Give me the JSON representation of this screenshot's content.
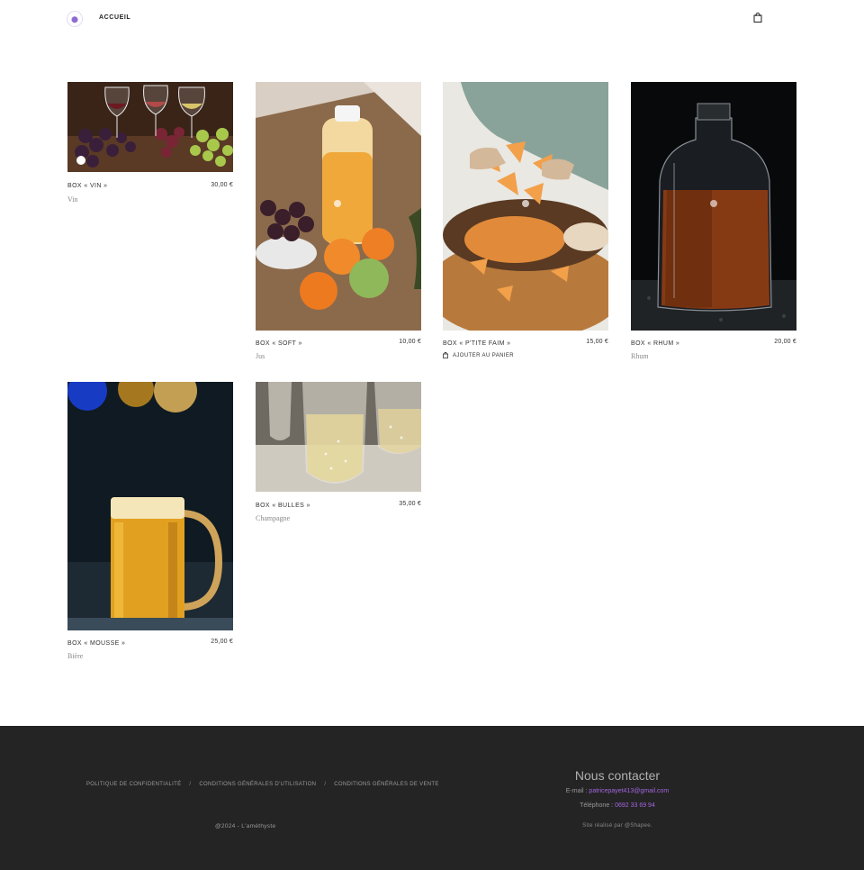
{
  "header": {
    "nav_home": "ACCUEIL"
  },
  "products": [
    {
      "title": "BOX « VIN »",
      "price": "30,00 €",
      "subtitle": "Vin"
    },
    {
      "title": "BOX « SOFT »",
      "price": "10,00 €",
      "subtitle": "Jus"
    },
    {
      "title": "BOX « P'TITE FAIM »",
      "price": "15,00 €",
      "action": "AJOUTER AU PANIER"
    },
    {
      "title": "BOX « RHUM »",
      "price": "20,00 €",
      "subtitle": "Rhum"
    },
    {
      "title": "BOX « MOUSSE »",
      "price": "25,00 €",
      "subtitle": "Bière"
    },
    {
      "title": "BOX « BULLES »",
      "price": "35,00 €",
      "subtitle": "Champagne"
    }
  ],
  "footer": {
    "links": [
      "POLITIQUE DE CONFIDENTIALITÉ",
      "CONDITIONS GÉNÉRALES D'UTILISATION",
      "CONDITIONS GÉNÉRALES DE VENTE"
    ],
    "separator": "/",
    "copyright": "@2024 - L'améthyste",
    "contact_title": "Nous contacter",
    "email_label": "E-mail :",
    "email": "patricepayet413@gmail.com",
    "phone_label": "Téléphone :",
    "phone": "0692 33 69 94",
    "credits": "Site réalisé par @Shapee."
  },
  "colors": {
    "accent": "#a365e0",
    "footer_bg": "#242424"
  }
}
